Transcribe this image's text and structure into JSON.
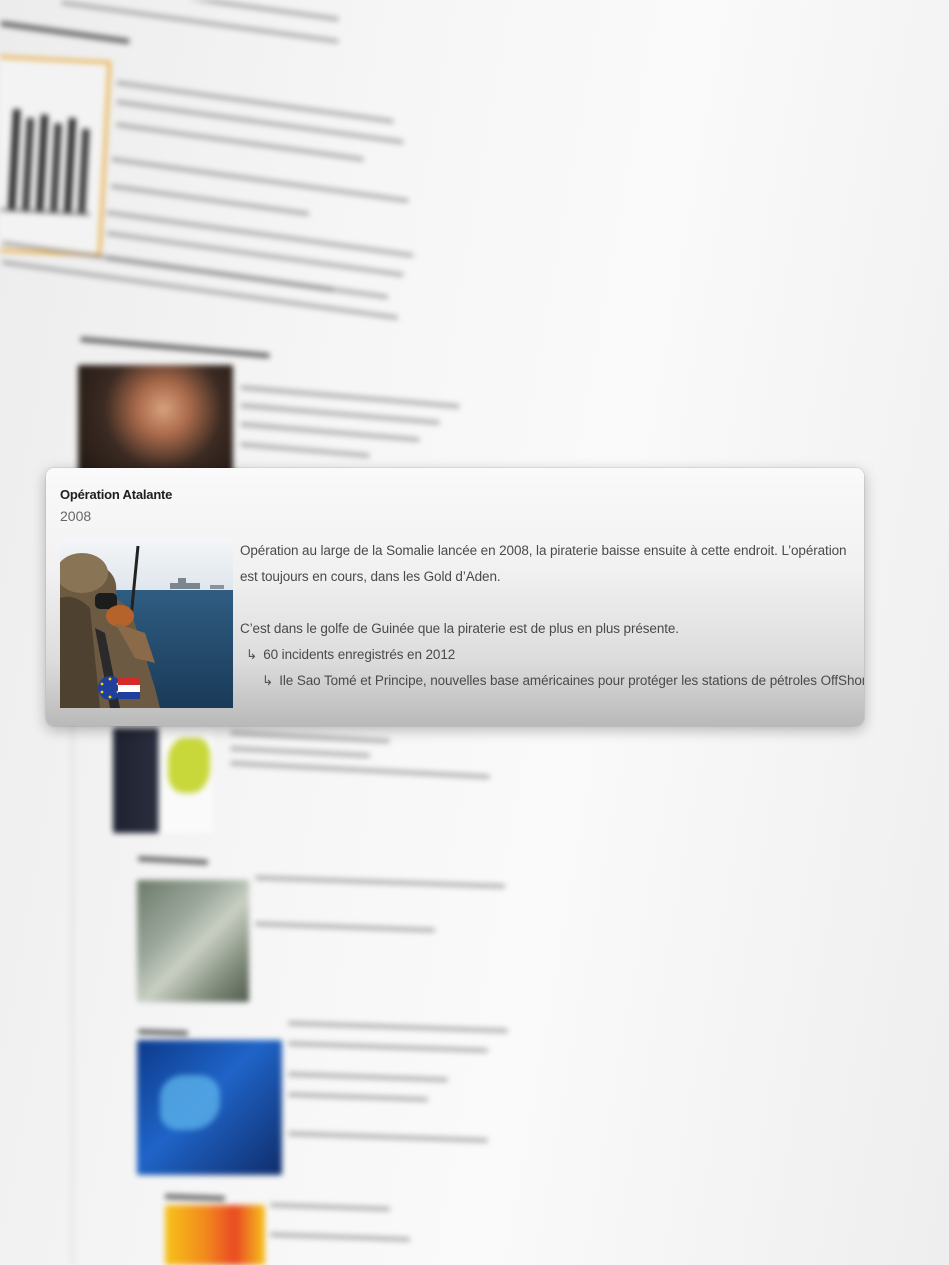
{
  "popup": {
    "title": "Opération Atalante",
    "year": "2008",
    "paragraph1": "Opération au large de la Somalie lancée en 2008, la piraterie baisse ensuite à cette endroit. L’opération est toujours en cours, dans les Gold d’Aden.",
    "paragraph2": "C’est dans le golfe de Guinée que la piraterie est de plus en plus présente.",
    "bullet1": "60 incidents enregistrés en 2012",
    "bullet2": "Ile Sao Tomé et Principe, nouvelles base américaines pour protéger les stations de pétroles OffShore.",
    "arrow_glyph": "↳",
    "photo_icon": "soldier-photo"
  },
  "colors": {
    "card_top": "#fafafa",
    "card_bottom": "#b9b9b9",
    "title": "#1e1e1e",
    "text": "#4a4a4a",
    "chart_border": "#e8a93a",
    "flag_red": "#d42a2a",
    "flag_blue": "#1f3f9c"
  }
}
